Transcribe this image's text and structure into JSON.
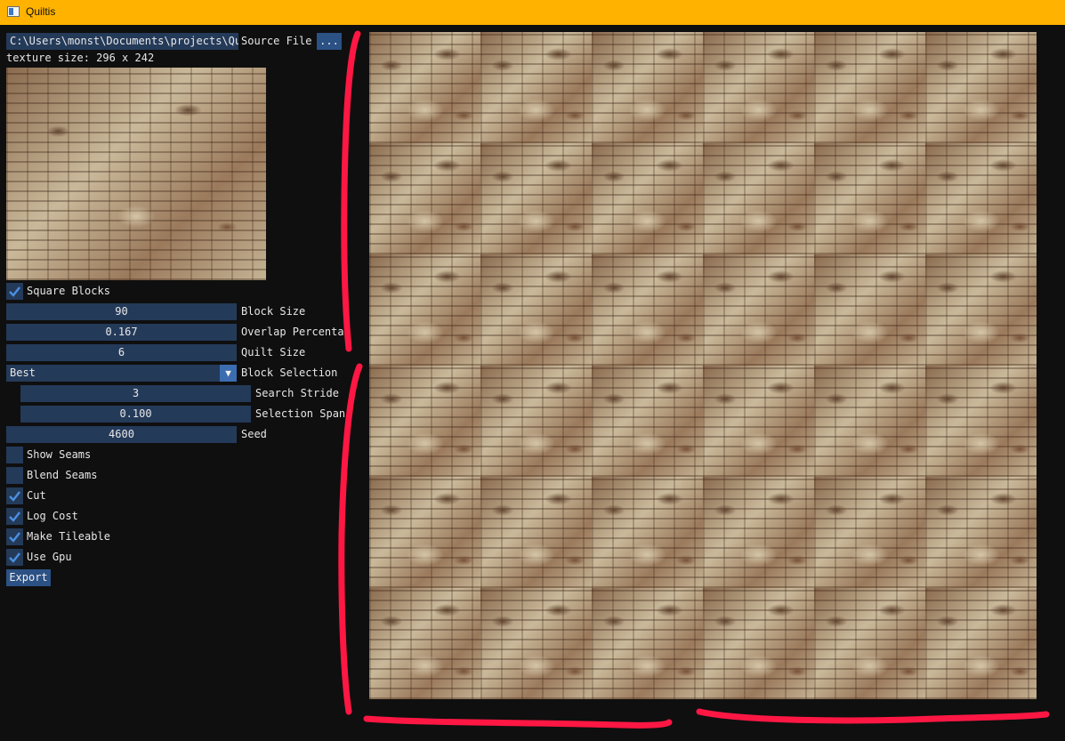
{
  "window": {
    "title": "Quiltis",
    "icon": "app-window-icon"
  },
  "source": {
    "path_value": "C:\\Users\\monst\\Documents\\projects\\Qui",
    "label": "Source File",
    "browse_label": "..."
  },
  "texture_info": "texture size: 296 x 242",
  "controls": {
    "square_blocks": {
      "label": "Square Blocks",
      "checked": true
    },
    "block_size": {
      "value": "90",
      "label": "Block Size"
    },
    "overlap_percentage": {
      "value": "0.167",
      "label": "Overlap Percentag"
    },
    "quilt_size": {
      "value": "6",
      "label": "Quilt Size"
    },
    "block_selection": {
      "value": "Best",
      "label": "Block Selection",
      "arrow_icon": "dropdown-arrow-icon"
    },
    "search_stride": {
      "value": "3",
      "label": "Search Stride"
    },
    "selection_span": {
      "value": "0.100",
      "label": "Selection Span"
    },
    "seed": {
      "value": "4600",
      "label": "Seed"
    },
    "show_seams": {
      "label": "Show Seams",
      "checked": false
    },
    "blend_seams": {
      "label": "Blend Seams",
      "checked": false
    },
    "cut": {
      "label": "Cut",
      "checked": true
    },
    "log_cost": {
      "label": "Log Cost",
      "checked": true
    },
    "make_tileable": {
      "label": "Make Tileable",
      "checked": true
    },
    "use_gpu": {
      "label": "Use Gpu",
      "checked": true
    }
  },
  "export_label": "Export",
  "colors": {
    "titlebar": "#ffb300",
    "background": "#0f0f0f",
    "field": "#243a59",
    "button": "#2c5184",
    "check": "#4a90e2",
    "annotation": "#ff1744"
  }
}
